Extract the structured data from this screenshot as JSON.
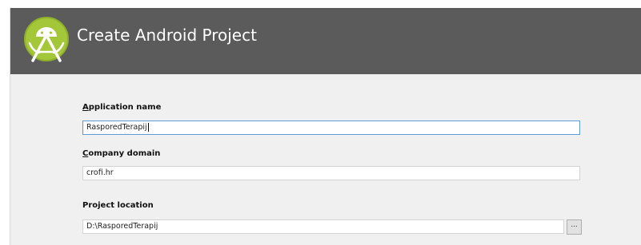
{
  "header": {
    "title": "Create Android Project"
  },
  "form": {
    "application_name": {
      "label_mnemonic": "A",
      "label_rest": "pplication name",
      "value": "RasporedTerapij"
    },
    "company_domain": {
      "label_mnemonic": "C",
      "label_rest": "ompany domain",
      "value": "crofi.hr"
    },
    "project_location": {
      "label": "Project location",
      "value": "D:\\RasporedTerapij",
      "browse_label": "..."
    }
  },
  "colors": {
    "header_bg": "#5b5b5b",
    "body_bg": "#f0f0f0",
    "logo_green": "#a4c639",
    "focus_border": "#5b9bd5"
  },
  "icons": {
    "logo": "android-studio-logo-icon"
  }
}
